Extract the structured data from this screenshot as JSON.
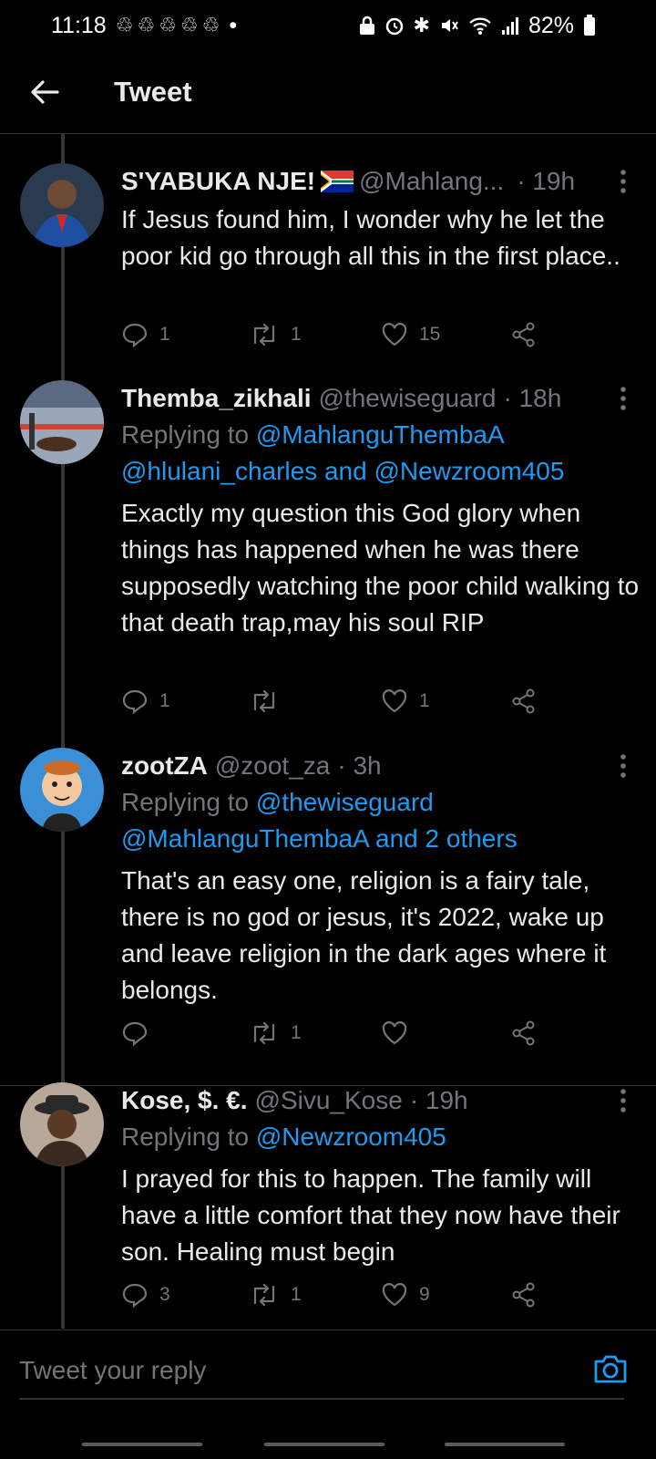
{
  "status_bar": {
    "time": "11:18",
    "notification_icons": [
      "recycle-icon",
      "recycle-icon",
      "recycle-icon",
      "recycle-icon",
      "recycle-icon"
    ],
    "dot": "•",
    "battery": "82%"
  },
  "header": {
    "title": "Tweet"
  },
  "colors": {
    "accent": "#1d9bf0",
    "muted": "#71767b",
    "background": "#000000",
    "text": "#e7e9ea"
  },
  "tweets": [
    {
      "name": "S'YABUKA NJE!",
      "has_flag": true,
      "handle": "@Mahlang...",
      "time": "· 19h",
      "replying_to": "",
      "text": "If Jesus found him, I wonder why he let the poor kid go through all this in the first place..",
      "replies": "1",
      "retweets": "1",
      "likes": "15"
    },
    {
      "name": "Themba_zikhali",
      "handle": "@thewiseguard",
      "time": "· 18h",
      "replying_prefix": "Replying to",
      "replying_line1": "@MahlanguThembaA",
      "replying_line2": "@hlulani_charles and @Newzroom405",
      "text": "Exactly my question this God glory when things has happened when he was there supposedly watching the poor child walking to that death trap,may his soul RIP",
      "replies": "1",
      "retweets": "",
      "likes": "1"
    },
    {
      "name": "zootZA",
      "handle": "@zoot_za",
      "time": "· 3h",
      "replying_prefix": "Replying to",
      "replying_line1": "@thewiseguard",
      "replying_line2": "@MahlanguThembaA and 2 others",
      "text": "That's an easy one, religion is a fairy tale, there is no god or jesus, it's 2022, wake up and leave religion in the dark ages where it belongs.",
      "replies": "",
      "retweets": "1",
      "likes": ""
    },
    {
      "name": "Kose, $. €.",
      "handle": "@Sivu_Kose",
      "time": "· 19h",
      "replying_prefix": "Replying to",
      "replying_line1": "@Newzroom405",
      "text": "I prayed for this to happen. The family will have a little comfort that they now have their son. Healing must begin",
      "replies": "3",
      "retweets": "1",
      "likes": "9"
    }
  ],
  "reply_bar": {
    "placeholder": "Tweet your reply"
  }
}
